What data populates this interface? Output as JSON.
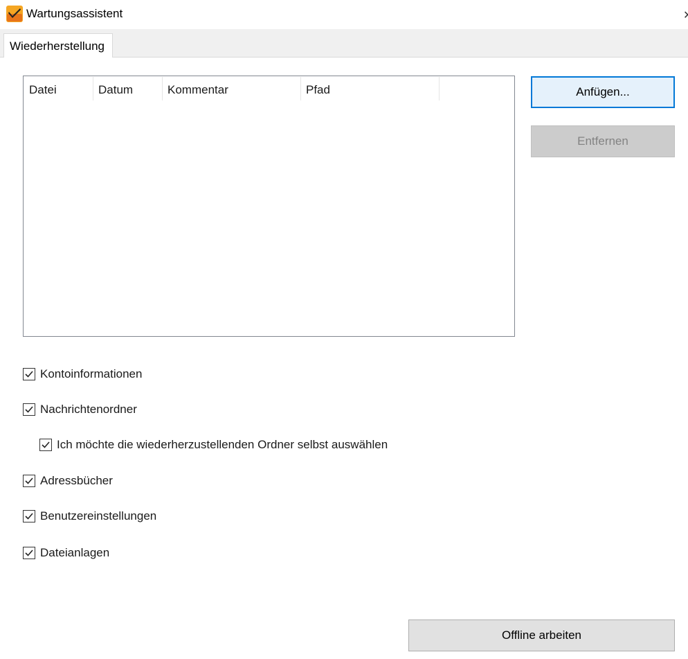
{
  "window": {
    "title": "Wartungsassistent",
    "icon": "app-logo-icon",
    "close_glyph": "✕"
  },
  "tabs": [
    {
      "label": "Wiederherstellung",
      "active": true
    }
  ],
  "list": {
    "columns": [
      "Datei",
      "Datum",
      "Kommentar",
      "Pfad"
    ],
    "rows": []
  },
  "buttons": {
    "add": "Anfügen...",
    "remove": "Entfernen",
    "offline": "Offline arbeiten"
  },
  "options": {
    "account_info": {
      "label": "Kontoinformationen",
      "checked": true
    },
    "message_folders": {
      "label": "Nachrichtenordner",
      "checked": true
    },
    "select_folders": {
      "label": "Ich möchte die wiederherzustellenden Ordner selbst auswählen",
      "checked": true
    },
    "address_books": {
      "label": "Adressbücher",
      "checked": true
    },
    "user_settings": {
      "label": "Benutzereinstellungen",
      "checked": true
    },
    "attachments": {
      "label": "Dateianlagen",
      "checked": true
    }
  },
  "colors": {
    "accent": "#0078d7",
    "disabled_text": "#838383"
  }
}
